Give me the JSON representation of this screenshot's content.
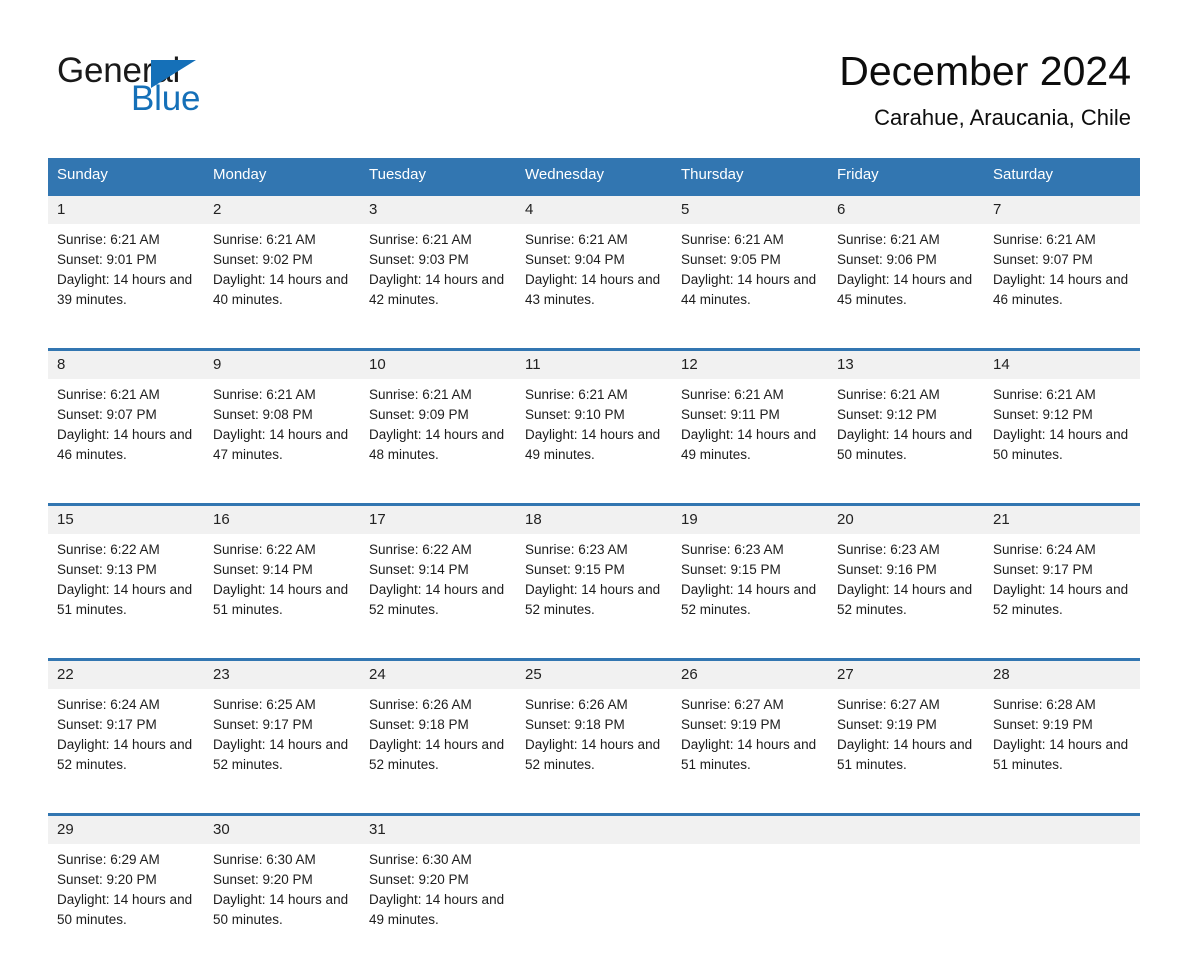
{
  "logo": {
    "word_one": "General",
    "word_two": "Blue",
    "mark": "triangle-icon"
  },
  "header": {
    "month_title": "December 2024",
    "location": "Carahue, Araucania, Chile"
  },
  "colors": {
    "header_blue": "#3276b1",
    "logo_blue": "#1570b8",
    "daynum_background": "#f1f1f1",
    "cell_background": "#ffffff",
    "text": "#1c1c1c"
  },
  "calendar": {
    "weekday_headers": [
      "Sunday",
      "Monday",
      "Tuesday",
      "Wednesday",
      "Thursday",
      "Friday",
      "Saturday"
    ],
    "weeks": [
      [
        {
          "day": "1",
          "sunrise": "Sunrise: 6:21 AM",
          "sunset": "Sunset: 9:01 PM",
          "daylight": "Daylight: 14 hours and 39 minutes."
        },
        {
          "day": "2",
          "sunrise": "Sunrise: 6:21 AM",
          "sunset": "Sunset: 9:02 PM",
          "daylight": "Daylight: 14 hours and 40 minutes."
        },
        {
          "day": "3",
          "sunrise": "Sunrise: 6:21 AM",
          "sunset": "Sunset: 9:03 PM",
          "daylight": "Daylight: 14 hours and 42 minutes."
        },
        {
          "day": "4",
          "sunrise": "Sunrise: 6:21 AM",
          "sunset": "Sunset: 9:04 PM",
          "daylight": "Daylight: 14 hours and 43 minutes."
        },
        {
          "day": "5",
          "sunrise": "Sunrise: 6:21 AM",
          "sunset": "Sunset: 9:05 PM",
          "daylight": "Daylight: 14 hours and 44 minutes."
        },
        {
          "day": "6",
          "sunrise": "Sunrise: 6:21 AM",
          "sunset": "Sunset: 9:06 PM",
          "daylight": "Daylight: 14 hours and 45 minutes."
        },
        {
          "day": "7",
          "sunrise": "Sunrise: 6:21 AM",
          "sunset": "Sunset: 9:07 PM",
          "daylight": "Daylight: 14 hours and 46 minutes."
        }
      ],
      [
        {
          "day": "8",
          "sunrise": "Sunrise: 6:21 AM",
          "sunset": "Sunset: 9:07 PM",
          "daylight": "Daylight: 14 hours and 46 minutes."
        },
        {
          "day": "9",
          "sunrise": "Sunrise: 6:21 AM",
          "sunset": "Sunset: 9:08 PM",
          "daylight": "Daylight: 14 hours and 47 minutes."
        },
        {
          "day": "10",
          "sunrise": "Sunrise: 6:21 AM",
          "sunset": "Sunset: 9:09 PM",
          "daylight": "Daylight: 14 hours and 48 minutes."
        },
        {
          "day": "11",
          "sunrise": "Sunrise: 6:21 AM",
          "sunset": "Sunset: 9:10 PM",
          "daylight": "Daylight: 14 hours and 49 minutes."
        },
        {
          "day": "12",
          "sunrise": "Sunrise: 6:21 AM",
          "sunset": "Sunset: 9:11 PM",
          "daylight": "Daylight: 14 hours and 49 minutes."
        },
        {
          "day": "13",
          "sunrise": "Sunrise: 6:21 AM",
          "sunset": "Sunset: 9:12 PM",
          "daylight": "Daylight: 14 hours and 50 minutes."
        },
        {
          "day": "14",
          "sunrise": "Sunrise: 6:21 AM",
          "sunset": "Sunset: 9:12 PM",
          "daylight": "Daylight: 14 hours and 50 minutes."
        }
      ],
      [
        {
          "day": "15",
          "sunrise": "Sunrise: 6:22 AM",
          "sunset": "Sunset: 9:13 PM",
          "daylight": "Daylight: 14 hours and 51 minutes."
        },
        {
          "day": "16",
          "sunrise": "Sunrise: 6:22 AM",
          "sunset": "Sunset: 9:14 PM",
          "daylight": "Daylight: 14 hours and 51 minutes."
        },
        {
          "day": "17",
          "sunrise": "Sunrise: 6:22 AM",
          "sunset": "Sunset: 9:14 PM",
          "daylight": "Daylight: 14 hours and 52 minutes."
        },
        {
          "day": "18",
          "sunrise": "Sunrise: 6:23 AM",
          "sunset": "Sunset: 9:15 PM",
          "daylight": "Daylight: 14 hours and 52 minutes."
        },
        {
          "day": "19",
          "sunrise": "Sunrise: 6:23 AM",
          "sunset": "Sunset: 9:15 PM",
          "daylight": "Daylight: 14 hours and 52 minutes."
        },
        {
          "day": "20",
          "sunrise": "Sunrise: 6:23 AM",
          "sunset": "Sunset: 9:16 PM",
          "daylight": "Daylight: 14 hours and 52 minutes."
        },
        {
          "day": "21",
          "sunrise": "Sunrise: 6:24 AM",
          "sunset": "Sunset: 9:17 PM",
          "daylight": "Daylight: 14 hours and 52 minutes."
        }
      ],
      [
        {
          "day": "22",
          "sunrise": "Sunrise: 6:24 AM",
          "sunset": "Sunset: 9:17 PM",
          "daylight": "Daylight: 14 hours and 52 minutes."
        },
        {
          "day": "23",
          "sunrise": "Sunrise: 6:25 AM",
          "sunset": "Sunset: 9:17 PM",
          "daylight": "Daylight: 14 hours and 52 minutes."
        },
        {
          "day": "24",
          "sunrise": "Sunrise: 6:26 AM",
          "sunset": "Sunset: 9:18 PM",
          "daylight": "Daylight: 14 hours and 52 minutes."
        },
        {
          "day": "25",
          "sunrise": "Sunrise: 6:26 AM",
          "sunset": "Sunset: 9:18 PM",
          "daylight": "Daylight: 14 hours and 52 minutes."
        },
        {
          "day": "26",
          "sunrise": "Sunrise: 6:27 AM",
          "sunset": "Sunset: 9:19 PM",
          "daylight": "Daylight: 14 hours and 51 minutes."
        },
        {
          "day": "27",
          "sunrise": "Sunrise: 6:27 AM",
          "sunset": "Sunset: 9:19 PM",
          "daylight": "Daylight: 14 hours and 51 minutes."
        },
        {
          "day": "28",
          "sunrise": "Sunrise: 6:28 AM",
          "sunset": "Sunset: 9:19 PM",
          "daylight": "Daylight: 14 hours and 51 minutes."
        }
      ],
      [
        {
          "day": "29",
          "sunrise": "Sunrise: 6:29 AM",
          "sunset": "Sunset: 9:20 PM",
          "daylight": "Daylight: 14 hours and 50 minutes."
        },
        {
          "day": "30",
          "sunrise": "Sunrise: 6:30 AM",
          "sunset": "Sunset: 9:20 PM",
          "daylight": "Daylight: 14 hours and 50 minutes."
        },
        {
          "day": "31",
          "sunrise": "Sunrise: 6:30 AM",
          "sunset": "Sunset: 9:20 PM",
          "daylight": "Daylight: 14 hours and 49 minutes."
        },
        {
          "day": "",
          "sunrise": "",
          "sunset": "",
          "daylight": ""
        },
        {
          "day": "",
          "sunrise": "",
          "sunset": "",
          "daylight": ""
        },
        {
          "day": "",
          "sunrise": "",
          "sunset": "",
          "daylight": ""
        },
        {
          "day": "",
          "sunrise": "",
          "sunset": "",
          "daylight": ""
        }
      ]
    ]
  }
}
